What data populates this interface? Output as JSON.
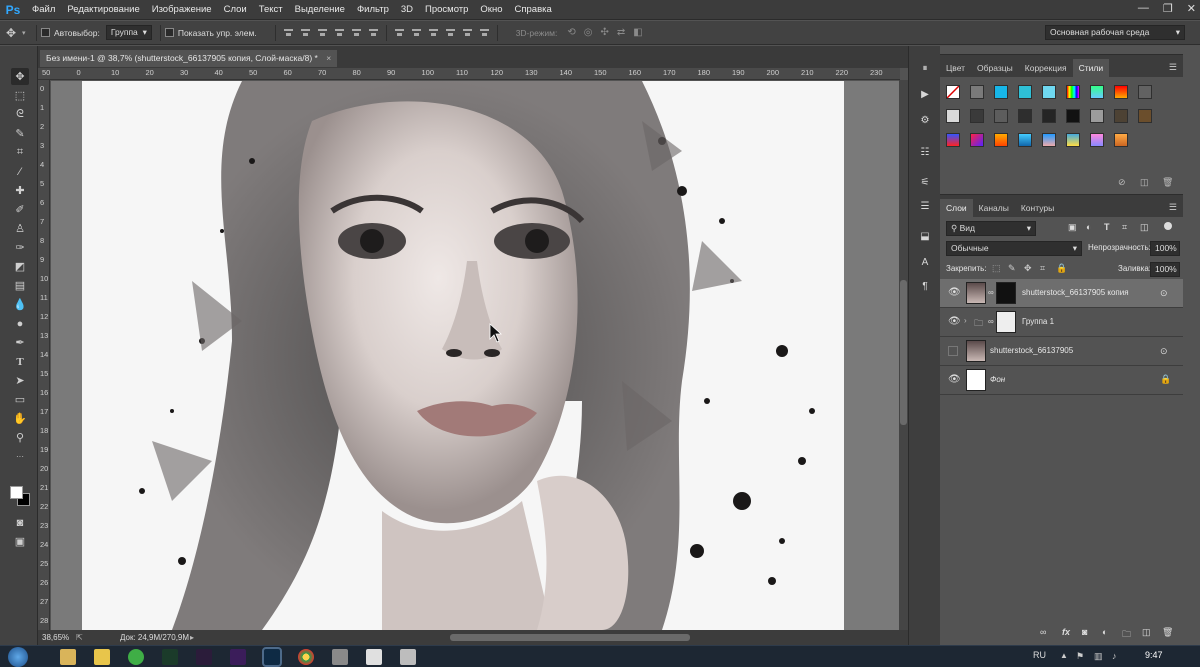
{
  "app": {
    "logo": "Ps",
    "menu": [
      "Файл",
      "Редактирование",
      "Изображение",
      "Слои",
      "Текст",
      "Выделение",
      "Фильтр",
      "3D",
      "Просмотр",
      "Окно",
      "Справка"
    ],
    "window_controls": [
      "—",
      "❐",
      "✕"
    ]
  },
  "options": {
    "autoselect_label": "Автовыбор:",
    "autoselect_value": "Группа",
    "show_transform_label": "Показать упр. элем.",
    "mode3d_label": "3D-режим:",
    "workspace": "Основная рабочая среда"
  },
  "document": {
    "tab_title": "Без имени-1 @ 38,7% (shutterstock_66137905 копия, Слой-маска/8) *",
    "tab_close": "×",
    "ruler_top": [
      "50",
      "0",
      "10",
      "20",
      "30",
      "40",
      "50",
      "60",
      "70",
      "80",
      "90",
      "100",
      "110",
      "120",
      "130",
      "140",
      "150",
      "160",
      "170",
      "180",
      "190",
      "200",
      "210",
      "220",
      "230"
    ],
    "ruler_left": [
      "0",
      "1",
      "2",
      "3",
      "4",
      "5",
      "6",
      "7",
      "8",
      "9",
      "10",
      "11",
      "12",
      "13",
      "14",
      "15",
      "16",
      "17",
      "18",
      "19",
      "20",
      "21",
      "22",
      "23",
      "24",
      "25",
      "26",
      "27",
      "28"
    ]
  },
  "status": {
    "zoom": "38,65%",
    "doc_info": "Док: 24,9M/270,9M"
  },
  "styles_panel": {
    "tabs": [
      "Цвет",
      "Образцы",
      "Коррекция",
      "Стили"
    ],
    "active_tab": "Стили"
  },
  "layers_panel": {
    "tabs": [
      "Слои",
      "Каналы",
      "Контуры"
    ],
    "active_tab": "Слои",
    "filter_kind": "Вид",
    "blend_mode": "Обычные",
    "opacity_label": "Непрозрачность:",
    "opacity_value": "100%",
    "lock_label": "Закрепить:",
    "fill_label": "Заливка:",
    "fill_value": "100%",
    "layers": [
      {
        "name": "shutterstock_66137905 копия",
        "visible": true,
        "selected": true
      },
      {
        "name": "Группа 1",
        "visible": true,
        "selected": false
      },
      {
        "name": "shutterstock_66137905",
        "visible": false,
        "selected": false
      },
      {
        "name": "Фон",
        "visible": true,
        "selected": false
      }
    ],
    "footer_icons": [
      "link-icon",
      "fx-icon",
      "mask-icon",
      "adjustment-icon",
      "folder-icon",
      "new-layer-icon",
      "trash-icon"
    ]
  },
  "taskbar": {
    "lang": "RU",
    "time": "9:47"
  }
}
